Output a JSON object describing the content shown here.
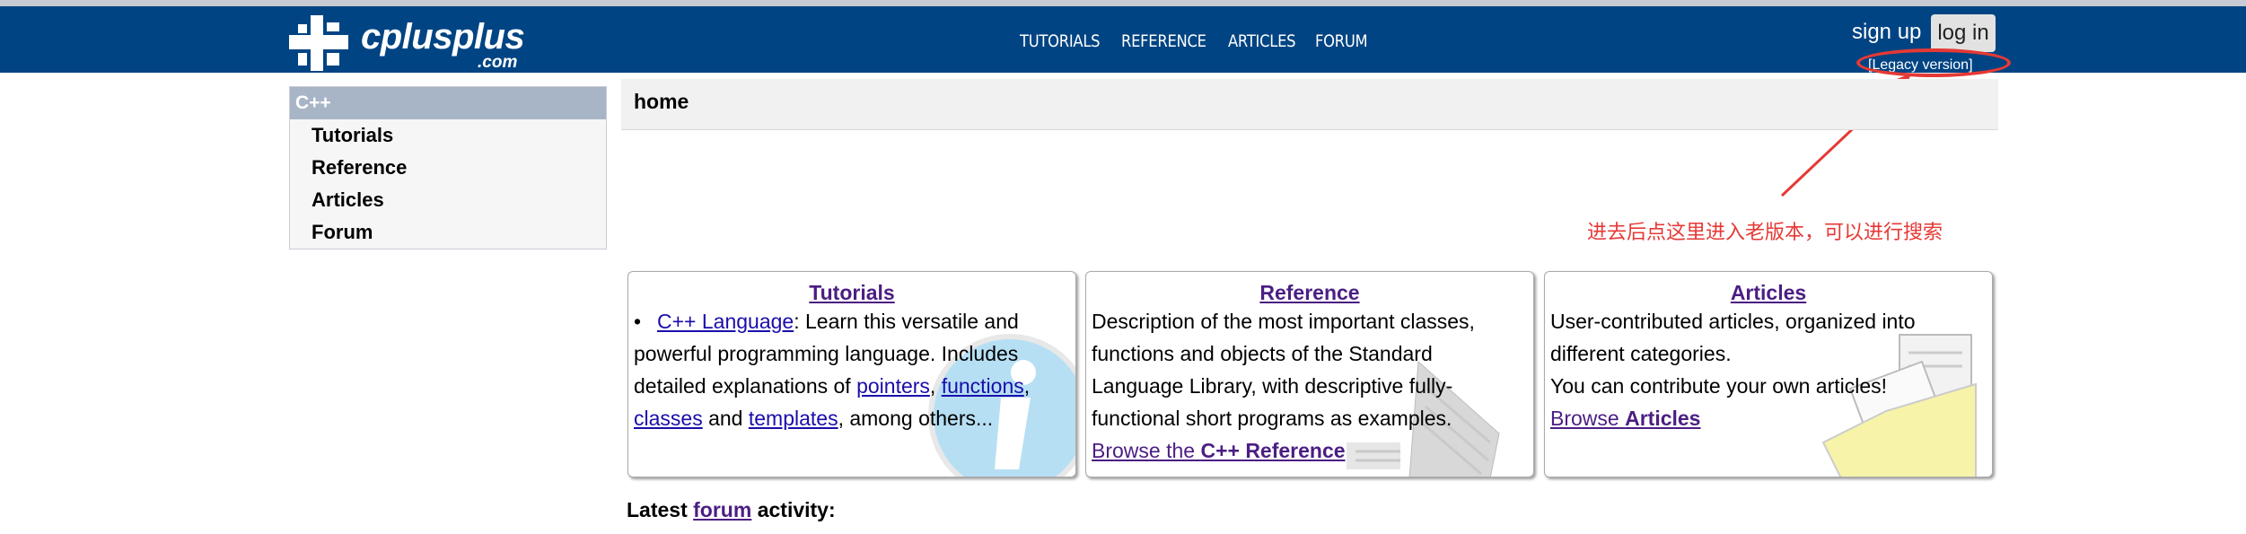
{
  "site": {
    "logo_text": "cplusplus",
    "logo_suffix": ".com"
  },
  "nav": {
    "items": [
      "TUTORIALS",
      "REFERENCE",
      "ARTICLES",
      "FORUM"
    ]
  },
  "account": {
    "signup": "sign up",
    "login": "log in",
    "legacy": "[Legacy version]"
  },
  "annotation": {
    "text": "进去后点这里进入老版本，可以进行搜索",
    "color": "#e53935"
  },
  "sidebar": {
    "title": "C++",
    "items": [
      "Tutorials",
      "Reference",
      "Articles",
      "Forum"
    ]
  },
  "content": {
    "title": "home"
  },
  "boxes": {
    "tutorials": {
      "title": "Tutorials",
      "link_cpp": "C++ Language",
      "text1": ": Learn this versatile and powerful programming language. Includes detailed explanations of ",
      "link_pointers": "pointers",
      "sep1": ", ",
      "link_functions": "functions",
      "sep2": ",",
      "link_classes": "classes",
      "and": " and ",
      "link_templates": "templates",
      "text2": ", among others..."
    },
    "reference": {
      "title": "Reference",
      "text": "Description of the most important classes, functions and objects of the Standard Language Library, with descriptive fully-functional short programs as examples.",
      "browse_prefix": "Browse the ",
      "browse_bold": "C++ Reference"
    },
    "articles": {
      "title": "Articles",
      "text1": "User-contributed articles, organized into different categories.",
      "text2": "You can contribute your own articles!",
      "browse_prefix": "Browse ",
      "browse_bold": "Articles"
    }
  },
  "latest": {
    "prefix": "Latest ",
    "link": "forum",
    "suffix": " activity:"
  },
  "colors": {
    "header": "#004483",
    "link_visited": "#4b1e83",
    "link": "#1a0dab"
  }
}
